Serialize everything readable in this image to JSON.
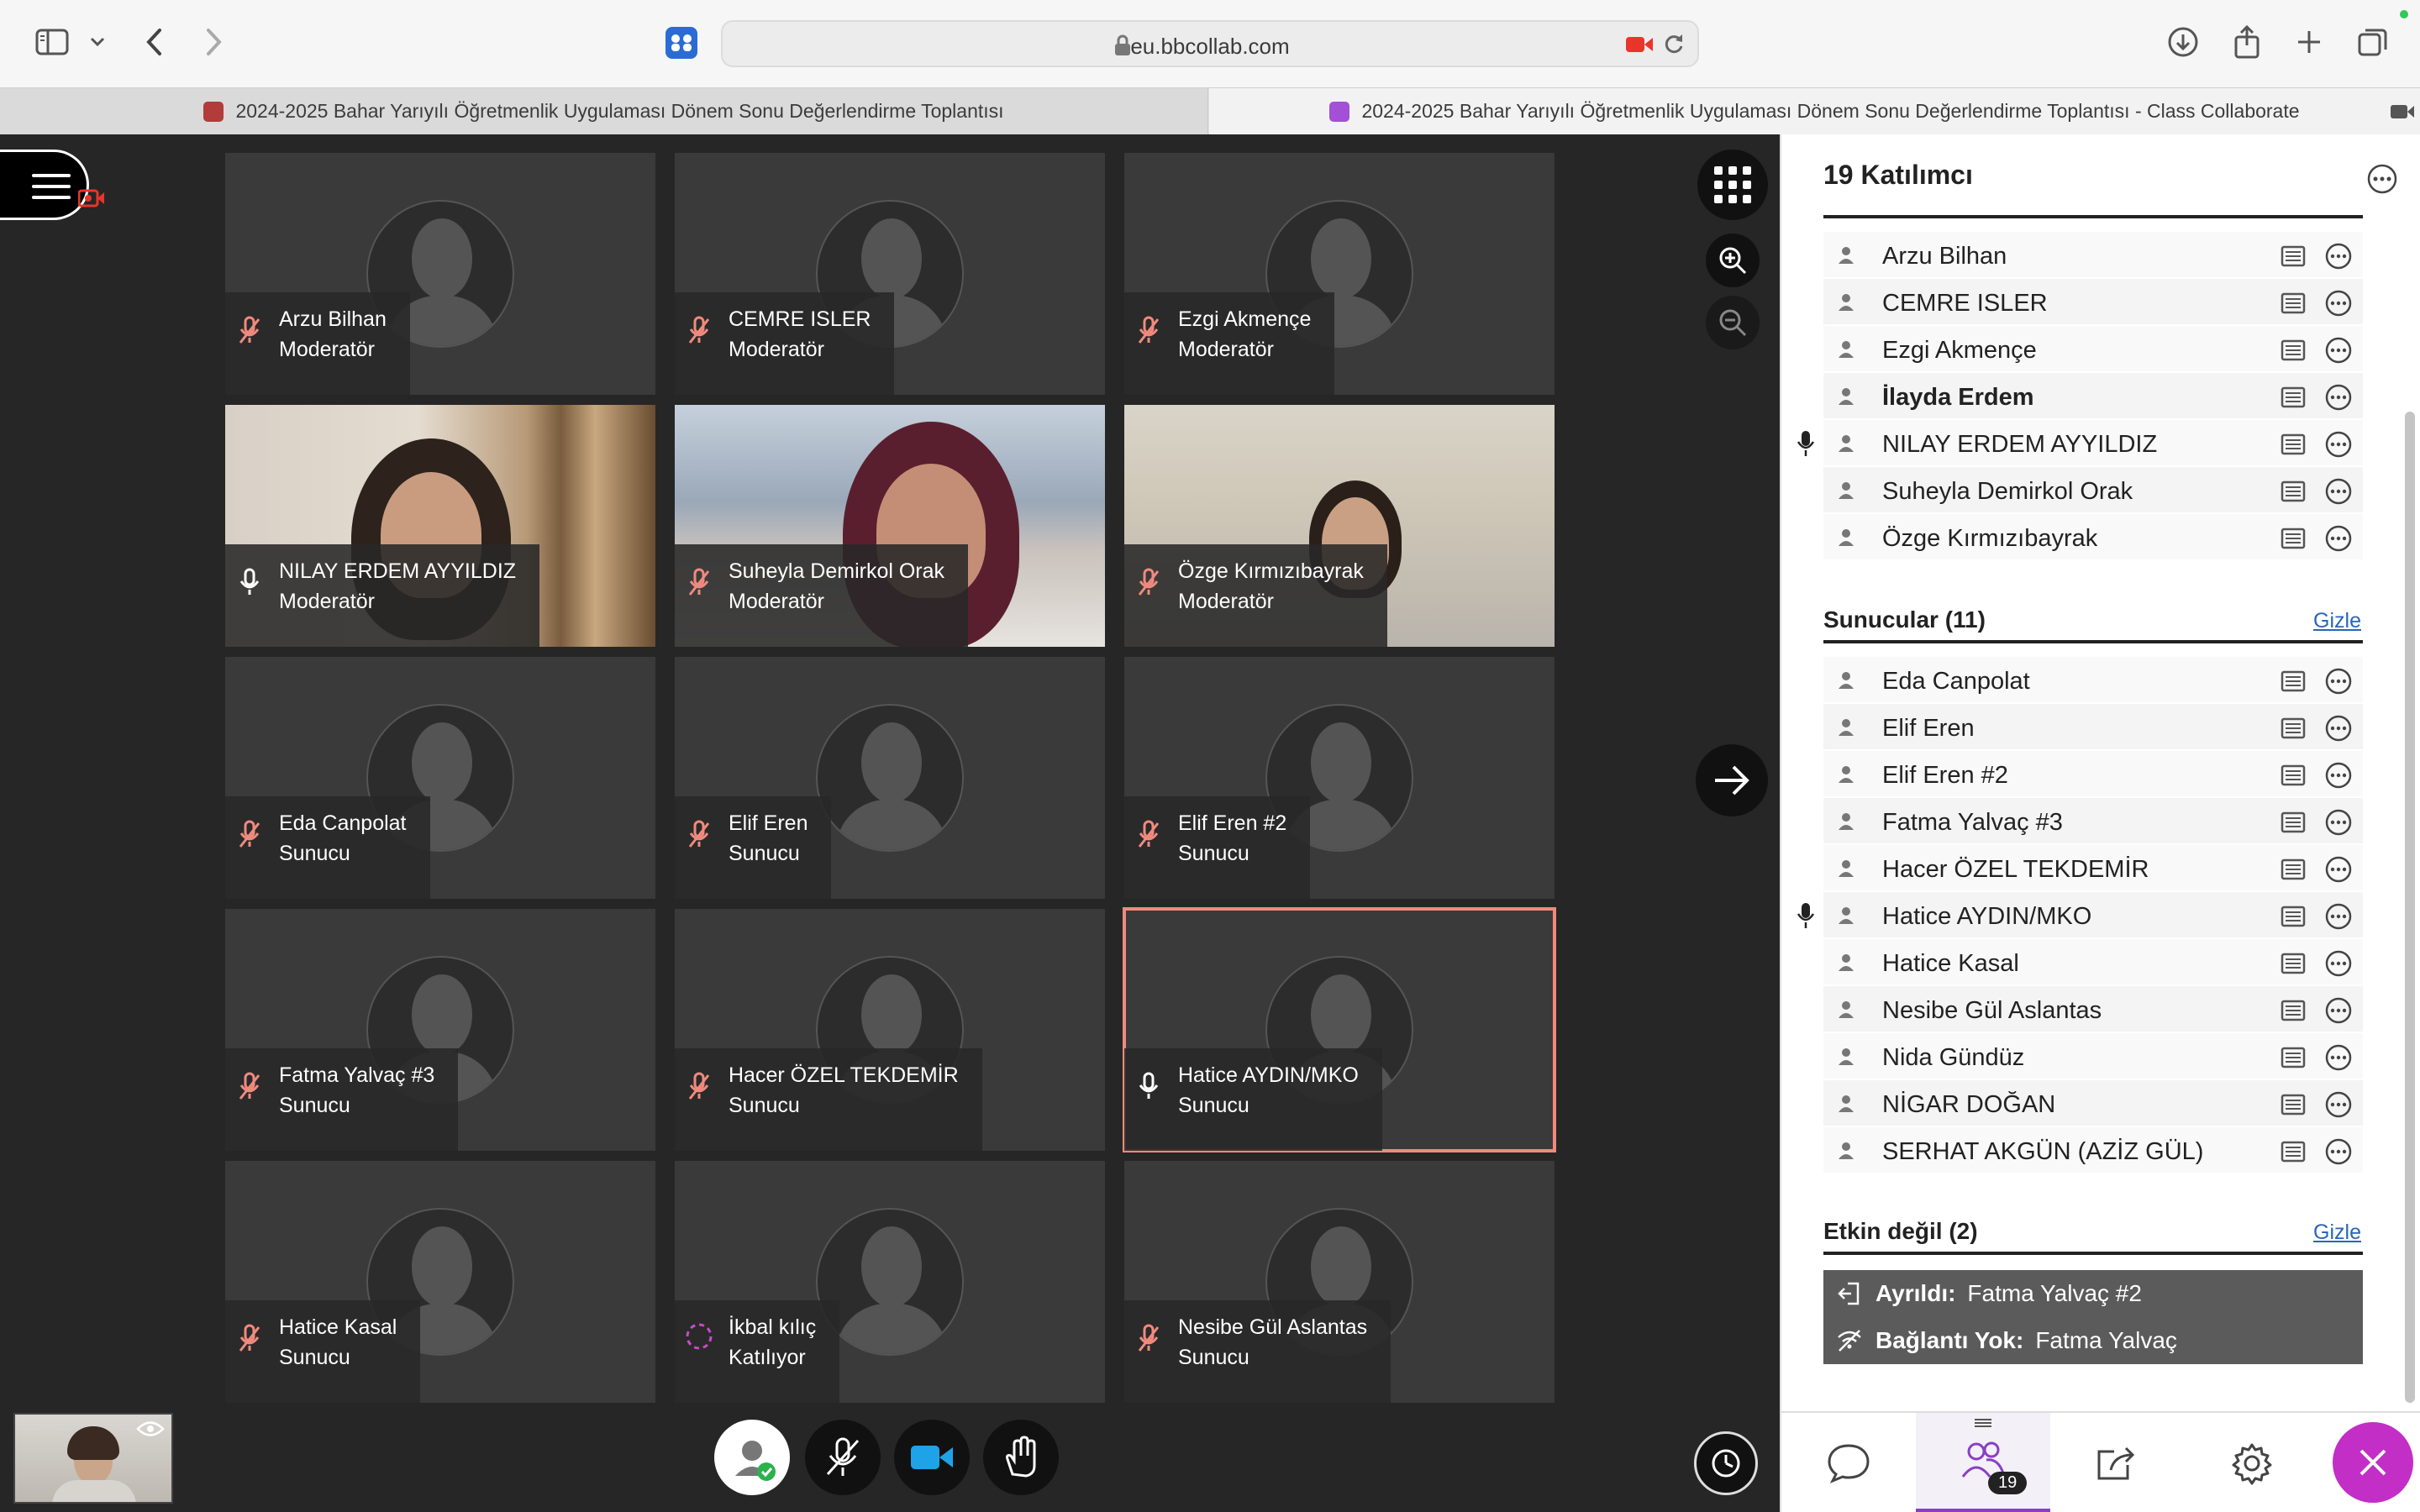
{
  "browser": {
    "url": "eu.bbcollab.com",
    "tabs": [
      {
        "title": "2024-2025 Bahar Yarıyılı Öğretmenlik Uygulaması Dönem Sonu Değerlendirme Toplantısı"
      },
      {
        "title": "2024-2025 Bahar Yarıyılı Öğretmenlik Uygulaması Dönem Sonu Değerlendirme Toplantısı - Class Collaborate"
      }
    ]
  },
  "tiles": [
    {
      "name": "Arzu Bilhan",
      "role": "Moderatör",
      "mic": "muted",
      "video": "none"
    },
    {
      "name": "CEMRE ISLER",
      "role": "Moderatör",
      "mic": "muted",
      "video": "none"
    },
    {
      "name": "Ezgi Akmençe",
      "role": "Moderatör",
      "mic": "muted",
      "video": "none"
    },
    {
      "name": "NILAY ERDEM AYYILDIZ",
      "role": "Moderatör",
      "mic": "on",
      "video": "v1"
    },
    {
      "name": "Suheyla Demirkol Orak",
      "role": "Moderatör",
      "mic": "muted",
      "video": "v2"
    },
    {
      "name": "Özge Kırmızıbayrak",
      "role": "Moderatör",
      "mic": "muted",
      "video": "v3"
    },
    {
      "name": "Eda Canpolat",
      "role": "Sunucu",
      "mic": "muted",
      "video": "none"
    },
    {
      "name": "Elif Eren",
      "role": "Sunucu",
      "mic": "muted",
      "video": "none"
    },
    {
      "name": "Elif Eren #2",
      "role": "Sunucu",
      "mic": "muted",
      "video": "none"
    },
    {
      "name": "Fatma Yalvaç #3",
      "role": "Sunucu",
      "mic": "muted",
      "video": "none"
    },
    {
      "name": "Hacer ÖZEL TEKDEMİR",
      "role": "Sunucu",
      "mic": "muted",
      "video": "none"
    },
    {
      "name": "Hatice AYDIN/MKO",
      "role": "Sunucu",
      "mic": "on",
      "video": "none",
      "active": true
    },
    {
      "name": "Hatice Kasal",
      "role": "Sunucu",
      "mic": "muted",
      "video": "none"
    },
    {
      "name": "İkbal kılıç",
      "role": "Katılıyor",
      "mic": "joining",
      "video": "none"
    },
    {
      "name": "Nesibe Gül Aslantas",
      "role": "Sunucu",
      "mic": "muted",
      "video": "none"
    }
  ],
  "panel": {
    "title": "19 Katılımcı",
    "moderators": [
      {
        "name": "Arzu Bilhan"
      },
      {
        "name": "CEMRE ISLER"
      },
      {
        "name": "Ezgi Akmençe"
      },
      {
        "name": "İlayda Erdem",
        "bold": true
      },
      {
        "name": "NILAY ERDEM AYYILDIZ",
        "speaking": true
      },
      {
        "name": "Suheyla Demirkol Orak"
      },
      {
        "name": "Özge Kırmızıbayrak"
      }
    ],
    "presenters_title": "Sunucular (11)",
    "presenters_hide": "Gizle",
    "presenters": [
      {
        "name": "Eda Canpolat"
      },
      {
        "name": "Elif Eren"
      },
      {
        "name": "Elif Eren #2"
      },
      {
        "name": "Fatma Yalvaç #3"
      },
      {
        "name": "Hacer ÖZEL TEKDEMİR"
      },
      {
        "name": "Hatice AYDIN/MKO",
        "speaking": true
      },
      {
        "name": "Hatice Kasal"
      },
      {
        "name": "Nesibe Gül Aslantas"
      },
      {
        "name": "Nida Gündüz"
      },
      {
        "name": "NİGAR DOĞAN"
      },
      {
        "name": "SERHAT AKGÜN (AZİZ GÜL)"
      }
    ],
    "inactive_title": "Etkin değil (2)",
    "inactive_hide": "Gizle",
    "inactive": [
      {
        "status": "Ayrıldı:",
        "name": "Fatma Yalvaç #2",
        "icon": "exit-icon"
      },
      {
        "status": "Bağlantı Yok:",
        "name": "Fatma Yalvaç",
        "icon": "no-signal-icon"
      }
    ],
    "participants_badge": "19"
  },
  "colors": {
    "accent": "#8a3fc4",
    "close": "#c22ec6",
    "active_outline": "#f08a7e",
    "link": "#2a66b8"
  }
}
